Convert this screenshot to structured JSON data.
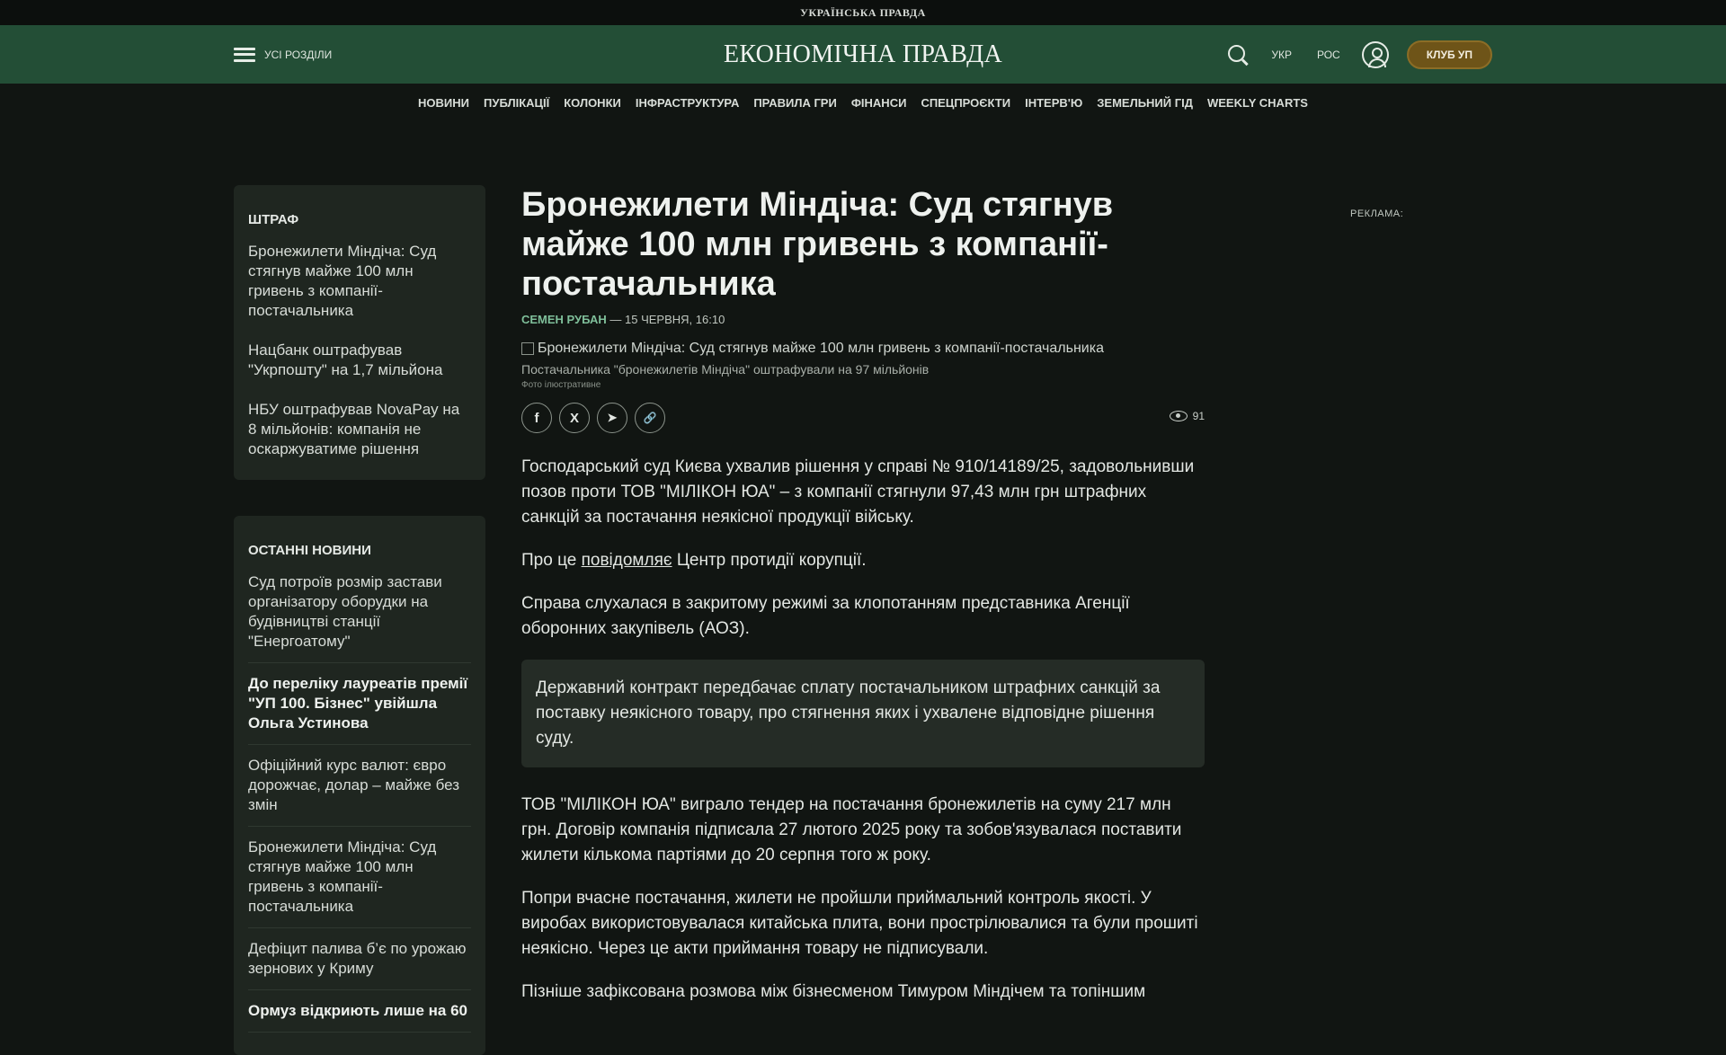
{
  "topbar": {
    "brand": "УКРАЇНСЬКА ПРАВДА"
  },
  "header": {
    "menu_label": "УСІ РОЗДІЛИ",
    "logo": "ЕКОНОМІЧНА ПРАВДА",
    "lang_ukr": "УКР",
    "lang_ros": "РОС",
    "club_button": "КЛУБ УП"
  },
  "nav": [
    "НОВИНИ",
    "ПУБЛІКАЦІЇ",
    "КОЛОНКИ",
    "ІНФРАСТРУКТУРА",
    "ПРАВИЛА ГРИ",
    "ФІНАНСИ",
    "СПЕЦПРОЄКТИ",
    "ІНТЕРВ'Ю",
    "ЗЕМЕЛЬНИЙ ГІД",
    "WEEKLY CHARTS"
  ],
  "sidebar": {
    "tag_box": {
      "title": "ШТРАФ",
      "items": [
        "Бронежилети Міндіча: Суд стягнув майже 100 млн гривень з компанії-постачальника",
        "Нацбанк оштрафував \"Укрпошту\" на 1,7 мільйона",
        "НБУ оштрафував NovaPay на 8 мільйонів: компанія не оскаржуватиме рішення"
      ]
    },
    "latest": {
      "title": "ОСТАННІ НОВИНИ",
      "items": [
        {
          "text": "Суд потроїв розмір застави організатору оборудки на будівництві станції \"Енергоатому\"",
          "bold": false
        },
        {
          "text": "До переліку лауреатів премії \"УП 100. Бізнес\" увійшла Ольга Устинова",
          "bold": true
        },
        {
          "text": "Офіційний курс валют: євро дорожчає, долар – майже без змін",
          "bold": false
        },
        {
          "text": "Бронежилети Міндіча: Суд стягнув майже 100 млн гривень з компанії-постачальника",
          "bold": false
        },
        {
          "text": "Дефіцит палива б’є по урожаю зернових у Криму",
          "bold": false
        },
        {
          "text": "Ормуз відкриють лише на 60",
          "bold": true
        }
      ]
    }
  },
  "article": {
    "headline": "Бронежилети Міндіча: Суд стягнув майже 100 млн гривень з компанії-постачальника",
    "author": "СЕМЕН РУБАН",
    "date": "— 15 ЧЕРВНЯ, 16:10",
    "image_alt": "Бронежилети Міндіча: Суд стягнув майже 100 млн гривень з компанії-постачальника",
    "caption": "Постачальника \"бронежилетів Міндіча\" оштрафували на 97 мільйонів",
    "photo_note": "Фото ілюстративне",
    "views": "91",
    "p1": "Господарський суд Києва ухвалив рішення у справі № 910/14189/25, задовольнивши позов проти ТОВ \"МІЛІКОН ЮА\" – з компанії стягнули 97,43 млн грн штрафних санкцій за постачання неякісної продукції війську.",
    "p2_before": "Про це ",
    "p2_link": "повідомляє",
    "p2_after": " Центр протидії корупції.",
    "p3": "Справа слухалася в закритому режимі за клопотанням представника Агенції оборонних закупівель (АОЗ).",
    "quote": "Державний контракт передбачає сплату постачальником штрафних санкцій за поставку неякісного товару, про стягнення яких і ухвалене відповідне рішення суду.",
    "p4": "ТОВ \"МІЛІКОН ЮА\" виграло тендер на постачання бронежилетів на суму 217 млн грн. Договір компанія підписала 27 лютого 2025 року та зобов'язувалася поставити жилети кількома партіями до 20 серпня того ж року.",
    "p5": "Попри вчасне постачання, жилети не пройшли приймальний контроль якості. У виробах використовувалася китайська плита, вони прострілювалися та були прошиті неякісно. Через це акти приймання товару не підписували.",
    "p6": "Пізніше зафіксована розмова між бізнесменом Тимуром Міндічем та топіншим"
  },
  "ad_label": "РЕКЛАМА:",
  "icons": {
    "facebook": "f",
    "x": "X",
    "telegram": "➤",
    "link": "🔗"
  }
}
